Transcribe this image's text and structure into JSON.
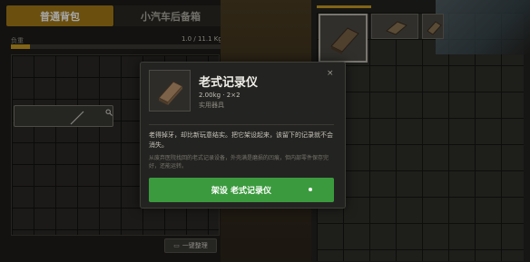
{
  "tabs": {
    "backpack": "普通背包",
    "trunk": "小汽车后备箱"
  },
  "capacity": {
    "label": "负重",
    "value": "1.0 / 11.1 Kg",
    "fill_fraction": 0.09
  },
  "sort_button": {
    "label": "一键整理"
  },
  "modal": {
    "title": "老式记录仪",
    "meta": "2.00kg · 2×2",
    "tagline": "实用器具",
    "description": "老得掉牙，却比新玩意结实。把它架设起来，该留下的记录就不会消失。",
    "note": "从废弃医院找回的老式记录设备，外壳满是磨损的凹痕，但内部零件保存完好，还能运转。",
    "action_label": "架设 老式记录仪",
    "close_glyph": "×"
  },
  "icons": [
    "search-icon",
    "sort-icon",
    "close-icon",
    "recorder-item-icon"
  ],
  "colors": {
    "accent": "#c79a22",
    "action": "#3b9a3e"
  }
}
